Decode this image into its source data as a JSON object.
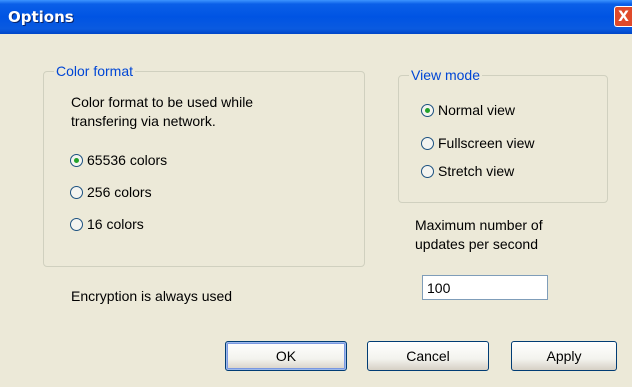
{
  "window": {
    "title": "Options",
    "close_glyph": "X"
  },
  "color_format": {
    "legend": "Color format",
    "description_line1": "Color format to be used while",
    "description_line2": "transfering via network.",
    "options": [
      {
        "label": "65536 colors",
        "selected": true
      },
      {
        "label": "256 colors",
        "selected": false
      },
      {
        "label": "16 colors",
        "selected": false
      }
    ]
  },
  "view_mode": {
    "legend": "View mode",
    "options": [
      {
        "label": "Normal view",
        "selected": true
      },
      {
        "label": "Fullscreen view",
        "selected": false
      },
      {
        "label": "Stretch view",
        "selected": false
      }
    ]
  },
  "updates": {
    "label_line1": "Maximum number of",
    "label_line2": "updates per second",
    "value": "100"
  },
  "encryption_note": "Encryption is always used",
  "buttons": {
    "ok": "OK",
    "cancel": "Cancel",
    "apply": "Apply"
  },
  "colors": {
    "titlebar": "#0054e3",
    "legend": "#0046d5",
    "background": "#ece9d8",
    "radio_dot": "#22a22a"
  }
}
